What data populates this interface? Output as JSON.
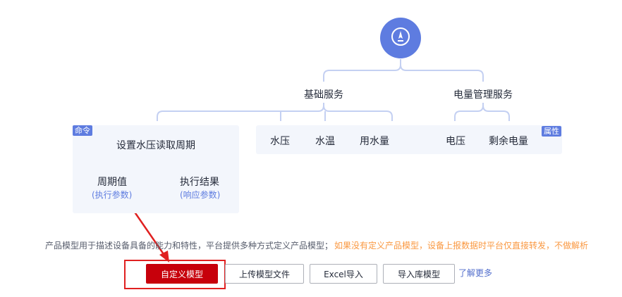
{
  "tree": {
    "root_icon": "compass-icon",
    "groups": [
      {
        "label": "基础服务"
      },
      {
        "label": "电量管理服务"
      }
    ],
    "command_panel": {
      "tag": "命令",
      "title": "设置水压读取周期",
      "children": [
        {
          "label": "周期值",
          "sub": "(执行参数)"
        },
        {
          "label": "执行结果",
          "sub": "(响应参数)"
        }
      ]
    },
    "property_panel": {
      "tag": "属性",
      "items": [
        "水压",
        "水温",
        "用水量",
        "电压",
        "剩余电量"
      ]
    }
  },
  "description": {
    "text": "产品模型用于描述设备具备的能力和特性，平台提供多种方式定义产品模型；",
    "warning": "如果没有定义产品模型，设备上报数据时平台仅直接转发，不做解析"
  },
  "actions": {
    "custom_model": "自定义模型",
    "upload_model": "上传模型文件",
    "excel_import": "Excel导入",
    "import_library": "导入库模型",
    "learn_more": "了解更多"
  },
  "colors": {
    "accent": "#5e7ce0",
    "primary_button": "#c7000b",
    "warning_text": "#fa9841",
    "annotation": "#e02020",
    "connector": "#c4d0f2"
  }
}
